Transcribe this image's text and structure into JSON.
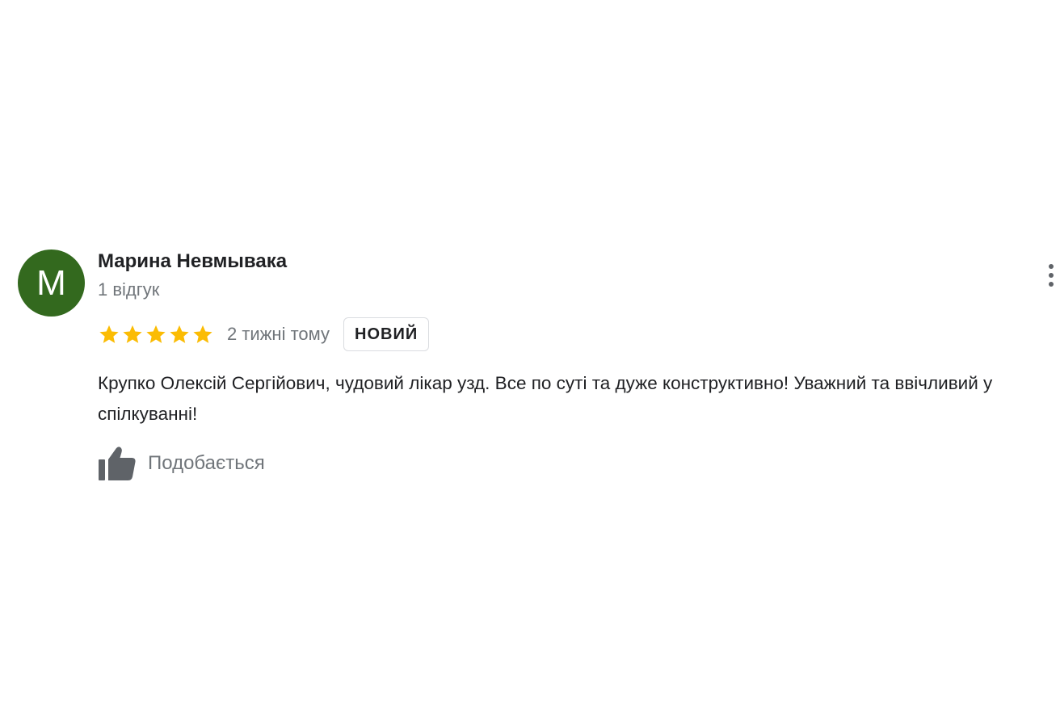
{
  "review": {
    "avatar_letter": "M",
    "avatar_color": "#33691e",
    "author_name": "Марина Невмывака",
    "author_meta": "1 відгук",
    "rating": 5,
    "rating_max": 5,
    "star_color": "#fbbc04",
    "time_ago": "2 тижні тому",
    "badge_label": "НОВИЙ",
    "text": "Крупко Олексій Сергійович, чудовий лікар узд. Все по суті та дуже конструктивно! Уважний та ввічливий у спілкуванні!",
    "like_label": "Подобається",
    "icons": {
      "more": "more-vertical-icon",
      "star": "star-icon",
      "like": "thumbs-up-icon"
    }
  }
}
